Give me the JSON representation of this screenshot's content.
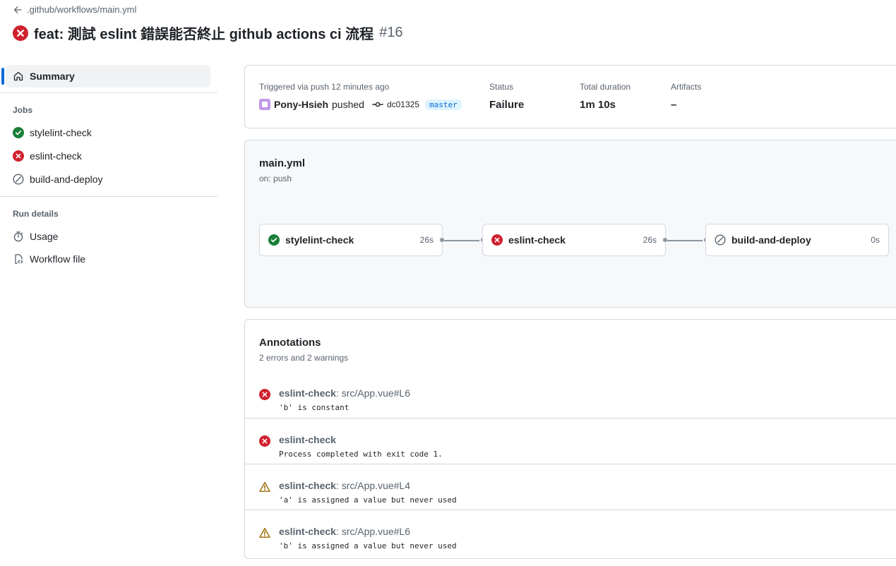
{
  "header": {
    "back_label": ".github/workflows/main.yml",
    "title": "feat: 測試 eslint 錯誤能否終止 github actions ci 流程",
    "run_number": "#16"
  },
  "sidebar": {
    "summary_label": "Summary",
    "jobs_heading": "Jobs",
    "jobs": [
      {
        "label": "stylelint-check",
        "status": "success",
        "icon": "check-circle-icon"
      },
      {
        "label": "eslint-check",
        "status": "failure",
        "icon": "x-circle-icon"
      },
      {
        "label": "build-and-deploy",
        "status": "skipped",
        "icon": "skip-icon"
      }
    ],
    "run_details_heading": "Run details",
    "run_details": [
      {
        "label": "Usage",
        "icon": "stopwatch-icon"
      },
      {
        "label": "Workflow file",
        "icon": "file-code-icon"
      }
    ]
  },
  "summary": {
    "trigger_label": "Triggered via push 12 minutes ago",
    "pusher": "Pony-Hsieh",
    "pushed_word": "pushed",
    "commit_sha": "dc01325",
    "branch": "master",
    "status_label": "Status",
    "status_value": "Failure",
    "duration_label": "Total duration",
    "duration_value": "1m 10s",
    "artifacts_label": "Artifacts",
    "artifacts_value": "–"
  },
  "workflow": {
    "name": "main.yml",
    "trigger": "on: push",
    "jobs": [
      {
        "name": "stylelint-check",
        "duration": "26s",
        "status": "success"
      },
      {
        "name": "eslint-check",
        "duration": "26s",
        "status": "failure"
      },
      {
        "name": "build-and-deploy",
        "duration": "0s",
        "status": "skipped"
      }
    ]
  },
  "annotations": {
    "title": "Annotations",
    "subtitle": "2 errors and 2 warnings",
    "items": [
      {
        "level": "error",
        "job": "eslint-check",
        "location": ": src/App.vue#L6",
        "message": "'b' is constant"
      },
      {
        "level": "error",
        "job": "eslint-check",
        "location": "",
        "message": "Process completed with exit code 1."
      },
      {
        "level": "warning",
        "job": "eslint-check",
        "location": ": src/App.vue#L4",
        "message": "'a' is assigned a value but never used"
      },
      {
        "level": "warning",
        "job": "eslint-check",
        "location": ": src/App.vue#L6",
        "message": "'b' is assigned a value but never used"
      }
    ]
  },
  "colors": {
    "success": "#1a7f37",
    "failure": "#cf222e",
    "warning": "#9a6700",
    "accent": "#0969da"
  }
}
